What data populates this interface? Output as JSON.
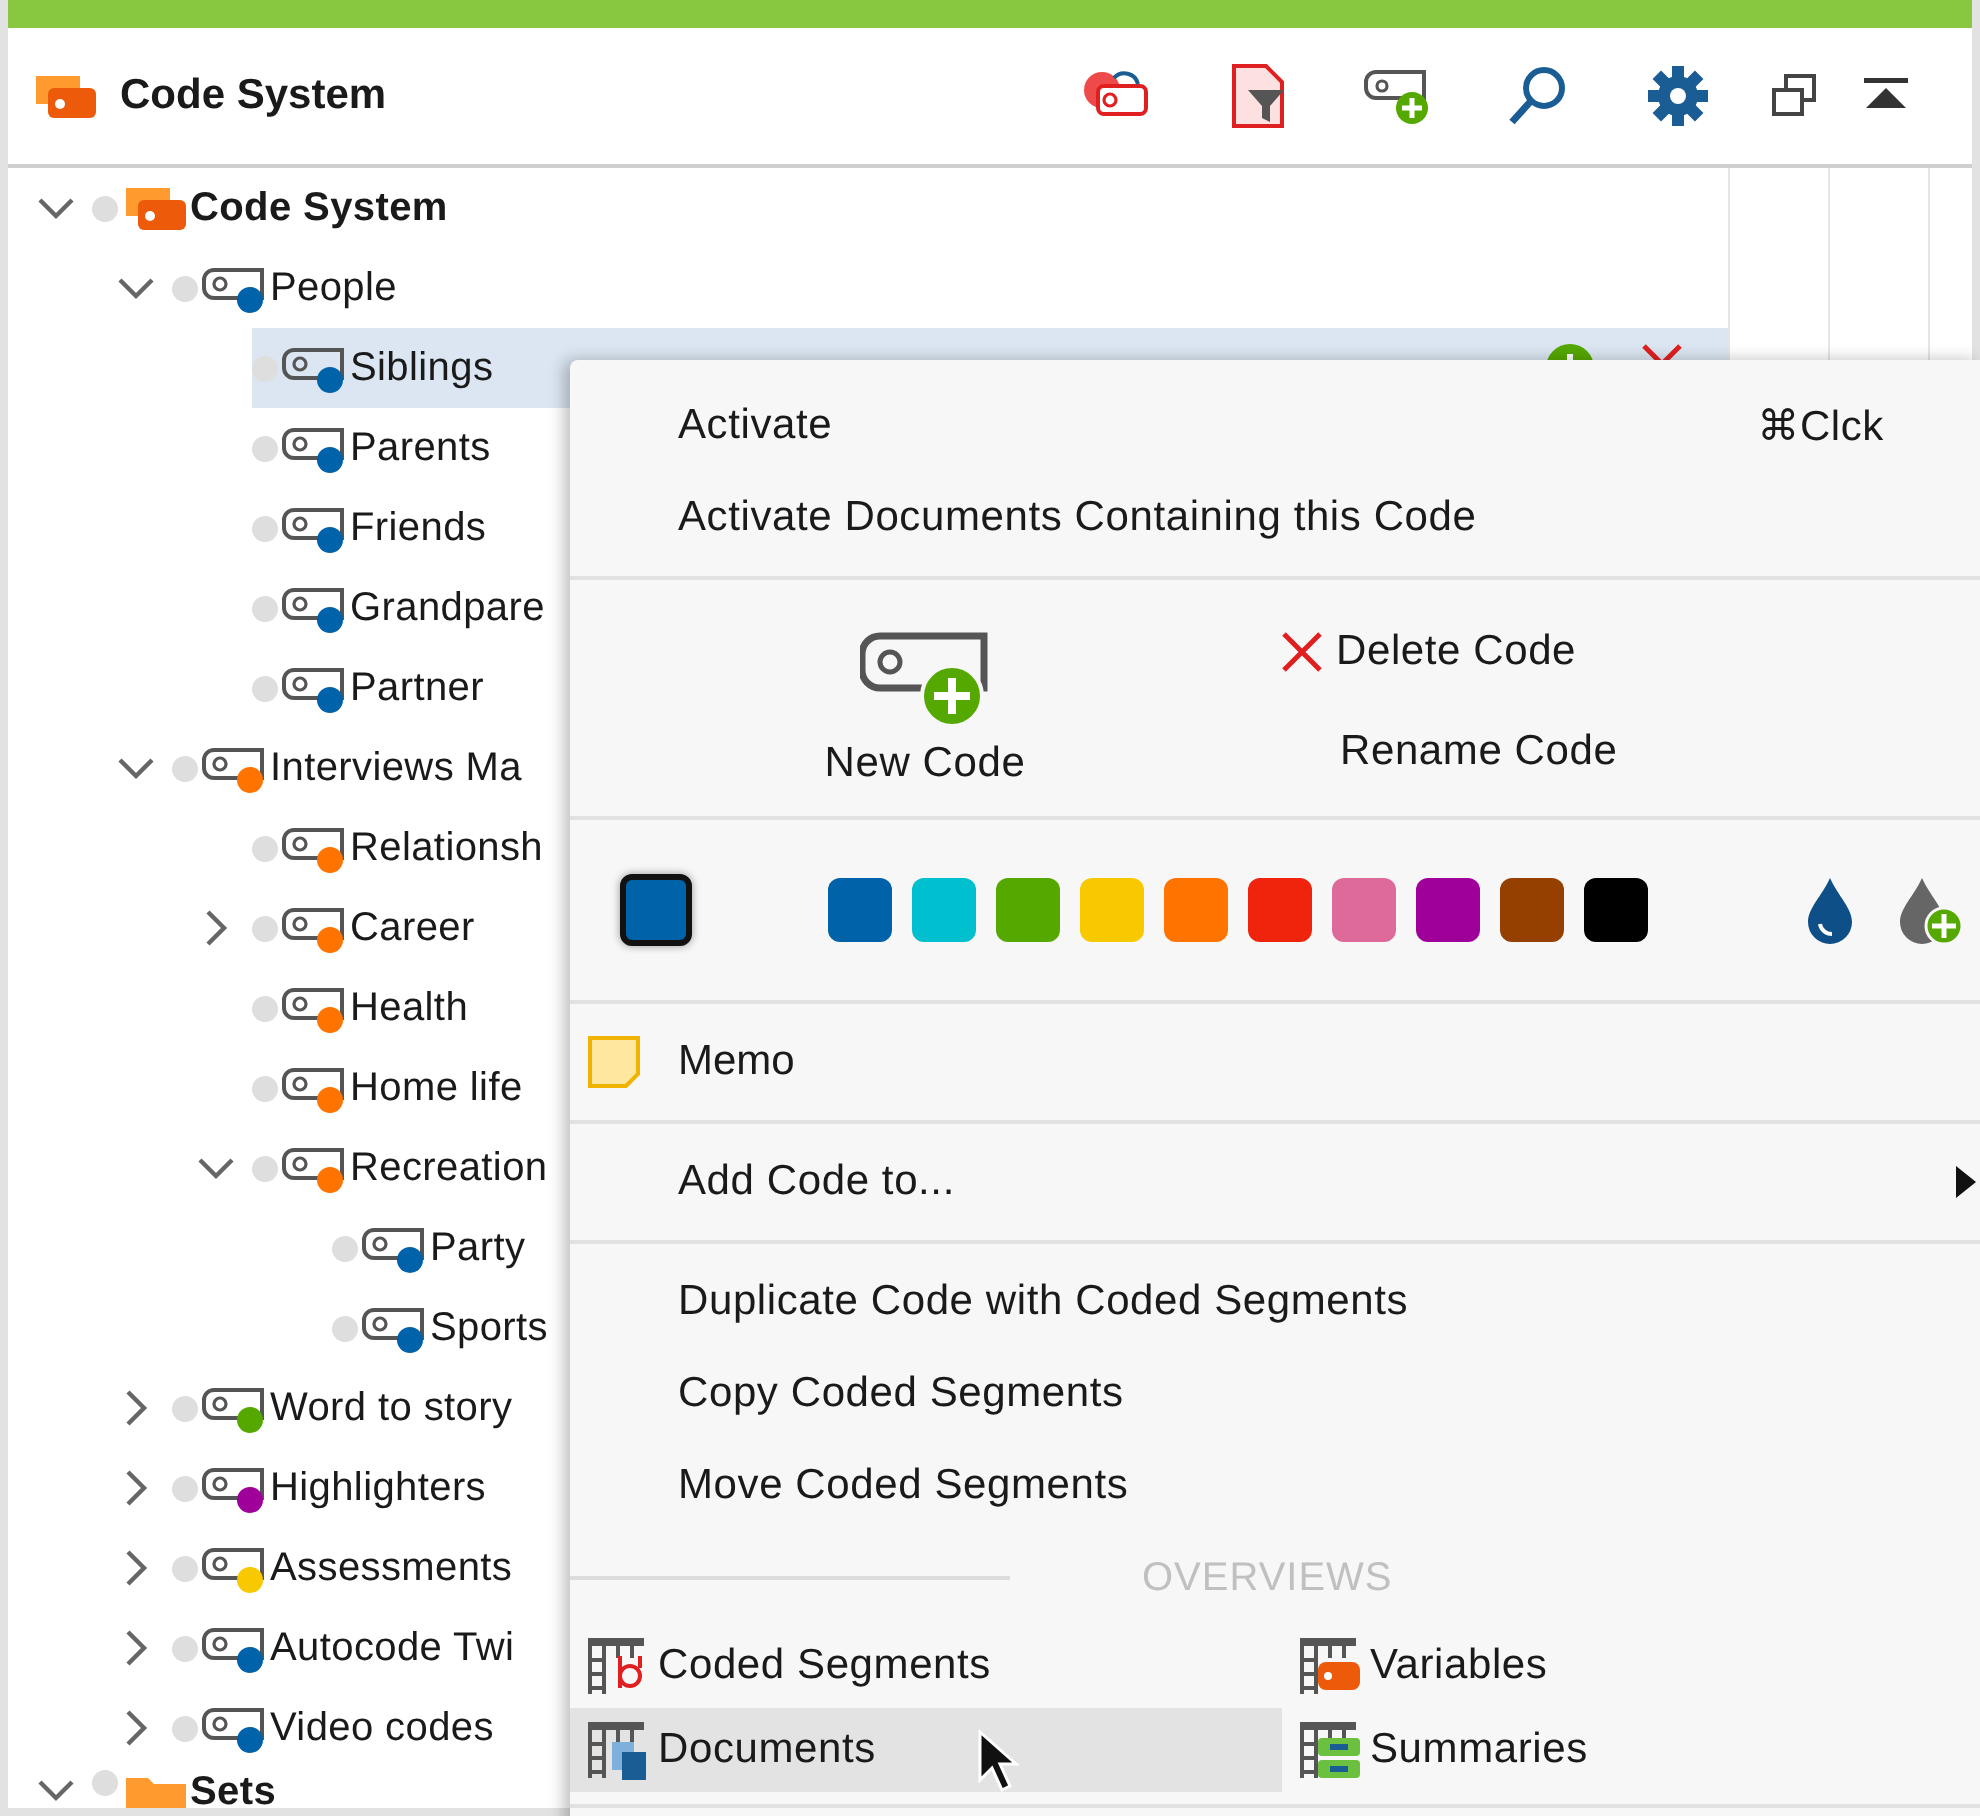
{
  "panel": {
    "title": "Code System"
  },
  "tree": [
    {
      "label": "Code System",
      "kind": "root",
      "expanded": true,
      "selected": false,
      "children": [
        {
          "label": "People",
          "kind": "code",
          "color": "#0062a8",
          "expanded": true,
          "selected": false,
          "children": [
            {
              "label": "Siblings",
              "kind": "code",
              "color": "#0062a8",
              "selected": true
            },
            {
              "label": "Parents",
              "kind": "code",
              "color": "#0062a8",
              "selected": false
            },
            {
              "label": "Friends",
              "kind": "code",
              "color": "#0062a8",
              "selected": false
            },
            {
              "label": "Grandpare",
              "kind": "code",
              "color": "#0062a8",
              "selected": false
            },
            {
              "label": "Partner",
              "kind": "code",
              "color": "#0062a8",
              "selected": false
            }
          ]
        },
        {
          "label": "Interviews Ma",
          "kind": "code",
          "color": "#ff7300",
          "expanded": true,
          "selected": false,
          "children": [
            {
              "label": "Relationsh",
              "kind": "code",
              "color": "#ff7300",
              "selected": false
            },
            {
              "label": "Career",
              "kind": "code",
              "color": "#ff7300",
              "expanded": false,
              "selected": false
            },
            {
              "label": "Health",
              "kind": "code",
              "color": "#ff7300",
              "selected": false
            },
            {
              "label": "Home life",
              "kind": "code",
              "color": "#ff7300",
              "selected": false
            },
            {
              "label": "Recreation",
              "kind": "code",
              "color": "#ff7300",
              "expanded": true,
              "selected": false,
              "children": [
                {
                  "label": "Party",
                  "kind": "code",
                  "color": "#0062a8",
                  "selected": false
                },
                {
                  "label": "Sports",
                  "kind": "code",
                  "color": "#0062a8",
                  "selected": false
                }
              ]
            }
          ]
        },
        {
          "label": "Word to story",
          "kind": "code",
          "color": "#55a800",
          "expanded": false,
          "selected": false
        },
        {
          "label": "Highlighters",
          "kind": "code",
          "color": "#a0009a",
          "expanded": false,
          "selected": false
        },
        {
          "label": "Assessments",
          "kind": "code",
          "color": "#f8c800",
          "expanded": false,
          "selected": false
        },
        {
          "label": "Autocode Twi",
          "kind": "code",
          "color": "#0062a8",
          "expanded": false,
          "selected": false
        },
        {
          "label": "Video codes",
          "kind": "code",
          "color": "#0062a8",
          "expanded": false,
          "selected": false
        }
      ]
    },
    {
      "label": "Sets",
      "kind": "set",
      "expanded": true,
      "selected": false
    }
  ],
  "context_menu": {
    "top_items": [
      {
        "label": "Activate",
        "shortcut": "⌘Clck"
      },
      {
        "label": "Activate Documents Containing this Code"
      }
    ],
    "new_code": "New Code",
    "delete_code": "Delete Code",
    "rename_code": "Rename Code",
    "palette": [
      {
        "color": "#0062a8"
      },
      {
        "color": "#00c0d0"
      },
      {
        "color": "#55a800"
      },
      {
        "color": "#f8c800"
      },
      {
        "color": "#ff7300"
      },
      {
        "color": "#f0240c"
      },
      {
        "color": "#de6a9a"
      },
      {
        "color": "#a0009a"
      },
      {
        "color": "#964000"
      },
      {
        "color": "#000000"
      }
    ],
    "memo": "Memo",
    "add_code_to": "Add Code to...",
    "segment_items": [
      "Duplicate Code with Coded Segments",
      "Copy Coded Segments",
      "Move Coded Segments"
    ],
    "overviews_heading": "OVERVIEWS",
    "overviews": [
      {
        "label": "Coded Segments",
        "kind": "segments",
        "selected": false
      },
      {
        "label": "Variables",
        "kind": "variables",
        "selected": false
      },
      {
        "label": "Documents",
        "kind": "documents",
        "selected": true
      },
      {
        "label": "Summaries",
        "kind": "summaries",
        "selected": false
      }
    ]
  }
}
